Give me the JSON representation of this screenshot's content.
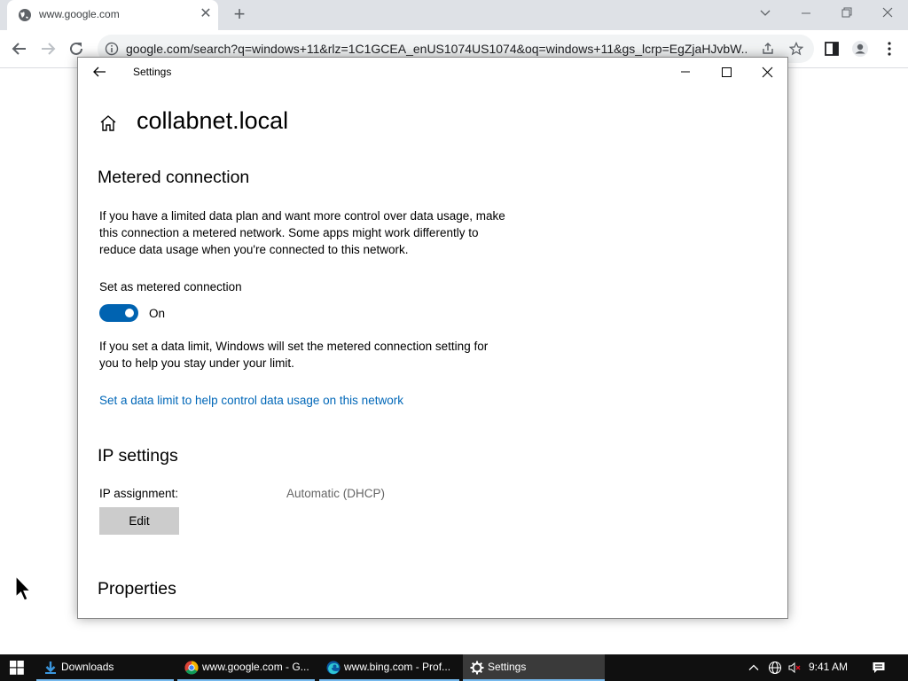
{
  "browser": {
    "tab_title": "www.google.com",
    "url": "google.com/search?q=windows+11&rlz=1C1GCEA_enUS1074US1074&oq=windows+11&gs_lcrp=EgZjaHJvbW..."
  },
  "settings": {
    "window_title": "Settings",
    "page_title": "collabnet.local",
    "metered": {
      "heading": "Metered connection",
      "description": "If you have a limited data plan and want more control over data usage, make this connection a metered network. Some apps might work differently to reduce data usage when you're connected to this network.",
      "toggle_label": "Set as metered connection",
      "toggle_state": "On",
      "limit_note": "If you set a data limit, Windows will set the metered connection setting for you to help you stay under your limit.",
      "limit_link": "Set a data limit to help control data usage on this network"
    },
    "ip": {
      "heading": "IP settings",
      "assignment_label": "IP assignment:",
      "assignment_value": "Automatic (DHCP)",
      "edit_button": "Edit"
    },
    "properties": {
      "heading": "Properties"
    }
  },
  "taskbar": {
    "items": [
      {
        "label": "Downloads",
        "icon": "downloads-icon"
      },
      {
        "label": "www.google.com - G...",
        "icon": "chrome-icon"
      },
      {
        "label": "www.bing.com - Prof...",
        "icon": "edge-icon"
      },
      {
        "label": "Settings",
        "icon": "gear-icon"
      }
    ],
    "clock": "9:41 AM"
  },
  "colors": {
    "accent": "#0063b1",
    "link": "#0067b8",
    "taskbar": "#101010"
  }
}
